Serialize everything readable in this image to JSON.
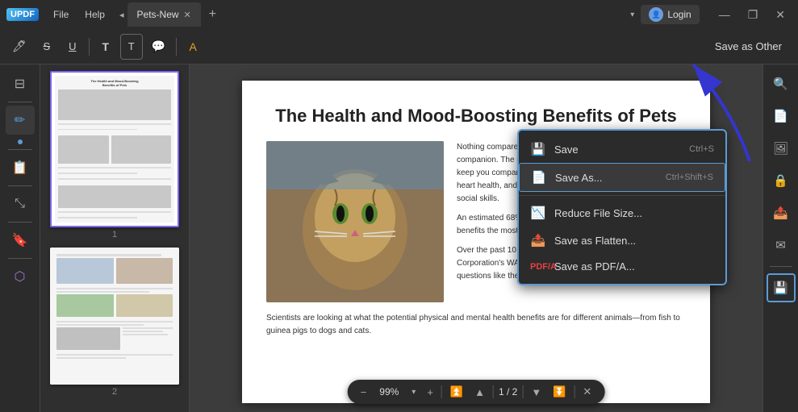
{
  "app": {
    "logo": "UPDF",
    "menu": [
      "File",
      "Help"
    ],
    "tab_name": "Pets-New",
    "login_label": "Login",
    "dropdown_arrow": "▾"
  },
  "win_controls": {
    "minimize": "—",
    "maximize": "❐",
    "close": "✕"
  },
  "toolbar": {
    "save_as_other": "Save as Other",
    "tools": [
      "🖊",
      "S̶",
      "U̲",
      "T",
      "⬜T",
      "💬",
      "|",
      "A"
    ]
  },
  "left_sidebar": {
    "icons": [
      "⊟",
      "—",
      "✏",
      "—",
      "📋",
      "—",
      "⤡",
      "—",
      "🔖",
      "—",
      "⬡"
    ]
  },
  "thumbnail_panel": {
    "page1_num": "1",
    "page2_num": "2"
  },
  "page": {
    "title": "The Health and Mood-Boosting Benefits of Pets",
    "paragraph1": "Nothing compares to the joy of coming home to a loyal companion. The unconditional love of a pet can do more than keep you company. Pets can also decrease stress, improve heart health, and even help children with their emotional and social skills.",
    "paragraph2": "An estimated 68% of U.S. households have a pet. But who benefits the most from having which type of pet?",
    "paragraph3": "Over the past 10 years, Mars has partnered with the Mars Corporation's WALTHAM Centre for Pet Nutrition to answer questions like these by funding research studies.",
    "paragraph4": "Scientists are looking at what the potential physical and mental health benefits are for different animals—from fish to guinea pigs to dogs and cats."
  },
  "bottom_bar": {
    "zoom": "99%",
    "page_indicator": "1 / 2"
  },
  "dropdown": {
    "title": "Save as Other",
    "items": [
      {
        "icon": "💾",
        "label": "Save",
        "shortcut": "Ctrl+S"
      },
      {
        "icon": "📄",
        "label": "Save As...",
        "shortcut": "Ctrl+Shift+S"
      },
      {
        "icon": "📉",
        "label": "Reduce File Size...",
        "shortcut": ""
      },
      {
        "icon": "📤",
        "label": "Save as Flatten...",
        "shortcut": ""
      },
      {
        "icon": "🅰",
        "label": "Save as PDF/A...",
        "shortcut": ""
      }
    ]
  },
  "right_sidebar": {
    "icons": [
      "🔍",
      "📄",
      "🖼",
      "🔒",
      "📤",
      "✉",
      "—",
      "💾"
    ]
  },
  "colors": {
    "accent": "#5b9bd5",
    "border_highlight": "#7b68ee",
    "arrow_color": "#3030cc"
  }
}
